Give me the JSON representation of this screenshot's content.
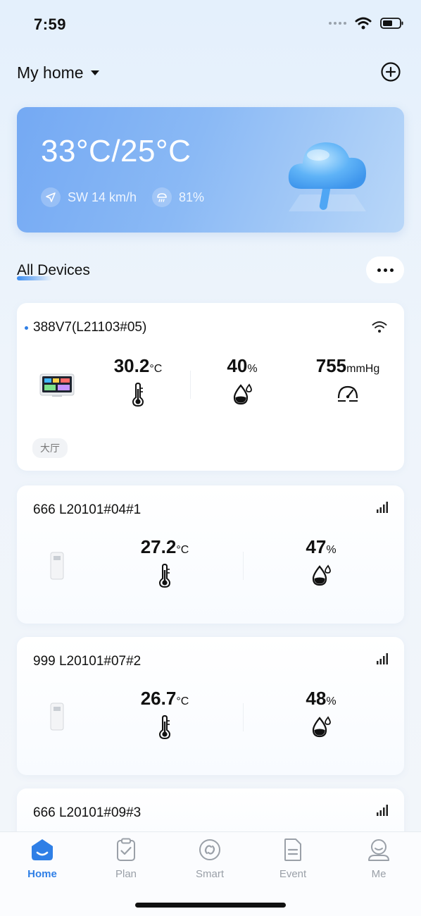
{
  "status_bar": {
    "time": "7:59"
  },
  "header": {
    "title": "My home"
  },
  "weather": {
    "temperature": "33°C/25°C",
    "wind": "SW 14 km/h",
    "humidity": "81%"
  },
  "section": {
    "title": "All Devices"
  },
  "devices": [
    {
      "name": "388V7(L21103#05)",
      "connection": "wifi-icon",
      "online": true,
      "metrics": [
        {
          "value": "30.2",
          "unit": "°C",
          "icon": "thermometer-icon"
        },
        {
          "value": "40",
          "unit": "%",
          "icon": "humidity-drop-icon"
        },
        {
          "value": "755",
          "unit": "mmHg",
          "icon": "pressure-gauge-icon"
        }
      ],
      "tag": "大厅"
    },
    {
      "name": "666 L20101#04#1",
      "connection": "signal-bars-icon",
      "metrics": [
        {
          "value": "27.2",
          "unit": "°C",
          "icon": "thermometer-icon"
        },
        {
          "value": "47",
          "unit": "%",
          "icon": "humidity-drop-icon"
        }
      ]
    },
    {
      "name": "999 L20101#07#2",
      "connection": "signal-bars-icon",
      "metrics": [
        {
          "value": "26.7",
          "unit": "°C",
          "icon": "thermometer-icon"
        },
        {
          "value": "48",
          "unit": "%",
          "icon": "humidity-drop-icon"
        }
      ]
    },
    {
      "name": "666 L20101#09#3",
      "connection": "signal-bars-icon"
    }
  ],
  "tabs": [
    {
      "label": "Home",
      "icon": "home-icon",
      "active": true
    },
    {
      "label": "Plan",
      "icon": "clipboard-check-icon"
    },
    {
      "label": "Smart",
      "icon": "smart-link-icon"
    },
    {
      "label": "Event",
      "icon": "document-icon"
    },
    {
      "label": "Me",
      "icon": "user-icon"
    }
  ],
  "colors": {
    "accent": "#2f7fe6",
    "weather_card": "#74a9f3",
    "background": "#eef4fb"
  }
}
